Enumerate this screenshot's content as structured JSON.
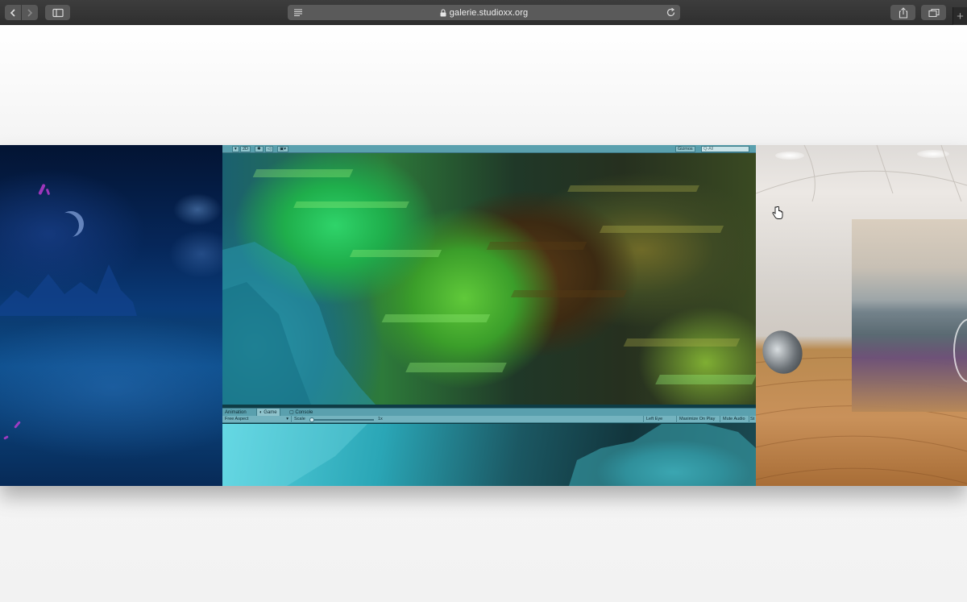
{
  "browser": {
    "url": "galerie.studioxx.org",
    "new_tab_glyph": "+"
  },
  "unity": {
    "top_bar": {
      "mode_2d": "2D",
      "gizmos": "Gizmos",
      "search_placeholder": "Q-All"
    },
    "tabs": [
      {
        "label": "Animation",
        "active": false
      },
      {
        "label": "Game",
        "active": true
      },
      {
        "label": "Console",
        "active": false
      }
    ],
    "game_bar": {
      "aspect": "Free Aspect",
      "scale_label": "Scale",
      "scale_value": "1x",
      "eye": "Left Eye",
      "maximize": "Maximize On Play",
      "mute": "Mute Audio",
      "stats": "St"
    }
  },
  "colors": {
    "toolbar": "#363636",
    "url_field": "#5a5a5a",
    "unity_chrome": "#5aa0ae"
  }
}
